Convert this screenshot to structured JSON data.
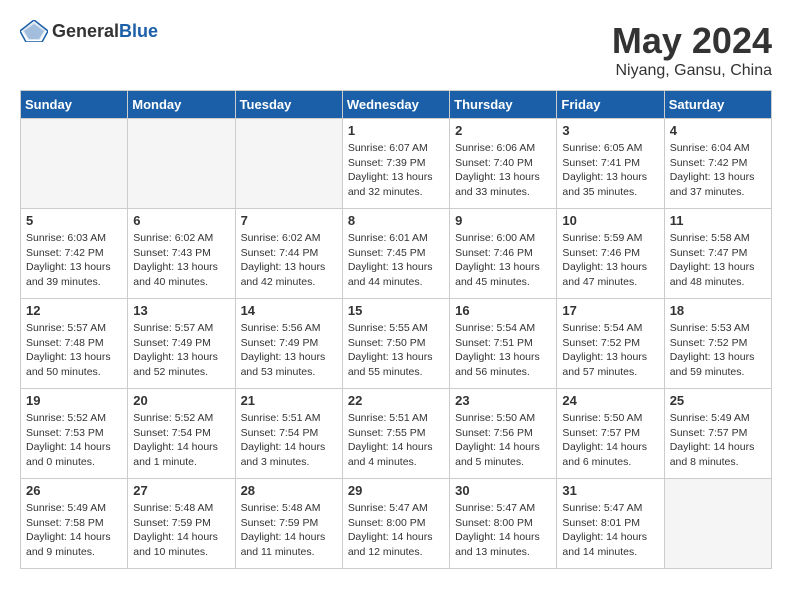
{
  "header": {
    "logo_general": "General",
    "logo_blue": "Blue",
    "month": "May 2024",
    "location": "Niyang, Gansu, China"
  },
  "days_of_week": [
    "Sunday",
    "Monday",
    "Tuesday",
    "Wednesday",
    "Thursday",
    "Friday",
    "Saturday"
  ],
  "weeks": [
    [
      {
        "day": "",
        "info": ""
      },
      {
        "day": "",
        "info": ""
      },
      {
        "day": "",
        "info": ""
      },
      {
        "day": "1",
        "info": "Sunrise: 6:07 AM\nSunset: 7:39 PM\nDaylight: 13 hours\nand 32 minutes."
      },
      {
        "day": "2",
        "info": "Sunrise: 6:06 AM\nSunset: 7:40 PM\nDaylight: 13 hours\nand 33 minutes."
      },
      {
        "day": "3",
        "info": "Sunrise: 6:05 AM\nSunset: 7:41 PM\nDaylight: 13 hours\nand 35 minutes."
      },
      {
        "day": "4",
        "info": "Sunrise: 6:04 AM\nSunset: 7:42 PM\nDaylight: 13 hours\nand 37 minutes."
      }
    ],
    [
      {
        "day": "5",
        "info": "Sunrise: 6:03 AM\nSunset: 7:42 PM\nDaylight: 13 hours\nand 39 minutes."
      },
      {
        "day": "6",
        "info": "Sunrise: 6:02 AM\nSunset: 7:43 PM\nDaylight: 13 hours\nand 40 minutes."
      },
      {
        "day": "7",
        "info": "Sunrise: 6:02 AM\nSunset: 7:44 PM\nDaylight: 13 hours\nand 42 minutes."
      },
      {
        "day": "8",
        "info": "Sunrise: 6:01 AM\nSunset: 7:45 PM\nDaylight: 13 hours\nand 44 minutes."
      },
      {
        "day": "9",
        "info": "Sunrise: 6:00 AM\nSunset: 7:46 PM\nDaylight: 13 hours\nand 45 minutes."
      },
      {
        "day": "10",
        "info": "Sunrise: 5:59 AM\nSunset: 7:46 PM\nDaylight: 13 hours\nand 47 minutes."
      },
      {
        "day": "11",
        "info": "Sunrise: 5:58 AM\nSunset: 7:47 PM\nDaylight: 13 hours\nand 48 minutes."
      }
    ],
    [
      {
        "day": "12",
        "info": "Sunrise: 5:57 AM\nSunset: 7:48 PM\nDaylight: 13 hours\nand 50 minutes."
      },
      {
        "day": "13",
        "info": "Sunrise: 5:57 AM\nSunset: 7:49 PM\nDaylight: 13 hours\nand 52 minutes."
      },
      {
        "day": "14",
        "info": "Sunrise: 5:56 AM\nSunset: 7:49 PM\nDaylight: 13 hours\nand 53 minutes."
      },
      {
        "day": "15",
        "info": "Sunrise: 5:55 AM\nSunset: 7:50 PM\nDaylight: 13 hours\nand 55 minutes."
      },
      {
        "day": "16",
        "info": "Sunrise: 5:54 AM\nSunset: 7:51 PM\nDaylight: 13 hours\nand 56 minutes."
      },
      {
        "day": "17",
        "info": "Sunrise: 5:54 AM\nSunset: 7:52 PM\nDaylight: 13 hours\nand 57 minutes."
      },
      {
        "day": "18",
        "info": "Sunrise: 5:53 AM\nSunset: 7:52 PM\nDaylight: 13 hours\nand 59 minutes."
      }
    ],
    [
      {
        "day": "19",
        "info": "Sunrise: 5:52 AM\nSunset: 7:53 PM\nDaylight: 14 hours\nand 0 minutes."
      },
      {
        "day": "20",
        "info": "Sunrise: 5:52 AM\nSunset: 7:54 PM\nDaylight: 14 hours\nand 1 minute."
      },
      {
        "day": "21",
        "info": "Sunrise: 5:51 AM\nSunset: 7:54 PM\nDaylight: 14 hours\nand 3 minutes."
      },
      {
        "day": "22",
        "info": "Sunrise: 5:51 AM\nSunset: 7:55 PM\nDaylight: 14 hours\nand 4 minutes."
      },
      {
        "day": "23",
        "info": "Sunrise: 5:50 AM\nSunset: 7:56 PM\nDaylight: 14 hours\nand 5 minutes."
      },
      {
        "day": "24",
        "info": "Sunrise: 5:50 AM\nSunset: 7:57 PM\nDaylight: 14 hours\nand 6 minutes."
      },
      {
        "day": "25",
        "info": "Sunrise: 5:49 AM\nSunset: 7:57 PM\nDaylight: 14 hours\nand 8 minutes."
      }
    ],
    [
      {
        "day": "26",
        "info": "Sunrise: 5:49 AM\nSunset: 7:58 PM\nDaylight: 14 hours\nand 9 minutes."
      },
      {
        "day": "27",
        "info": "Sunrise: 5:48 AM\nSunset: 7:59 PM\nDaylight: 14 hours\nand 10 minutes."
      },
      {
        "day": "28",
        "info": "Sunrise: 5:48 AM\nSunset: 7:59 PM\nDaylight: 14 hours\nand 11 minutes."
      },
      {
        "day": "29",
        "info": "Sunrise: 5:47 AM\nSunset: 8:00 PM\nDaylight: 14 hours\nand 12 minutes."
      },
      {
        "day": "30",
        "info": "Sunrise: 5:47 AM\nSunset: 8:00 PM\nDaylight: 14 hours\nand 13 minutes."
      },
      {
        "day": "31",
        "info": "Sunrise: 5:47 AM\nSunset: 8:01 PM\nDaylight: 14 hours\nand 14 minutes."
      },
      {
        "day": "",
        "info": ""
      }
    ]
  ]
}
